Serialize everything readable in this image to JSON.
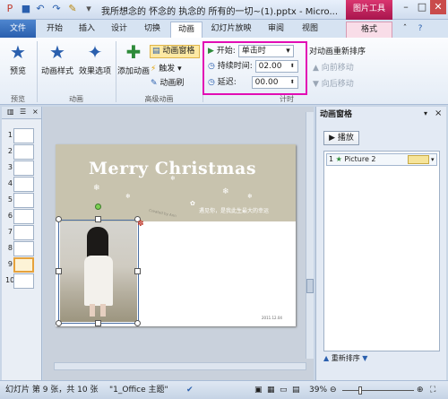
{
  "title_bar": {
    "doc_title": "我所想念的 怀念的 执念的 所有的一切~(1).pptx - Micro...",
    "picture_tools": "图片工具",
    "icons": [
      "save-icon",
      "undo-icon",
      "redo-icon",
      "format-painter-icon"
    ]
  },
  "tabs": {
    "file": "文件",
    "items": [
      "开始",
      "插入",
      "设计",
      "切换",
      "动画",
      "幻灯片放映",
      "审阅",
      "视图"
    ],
    "format": "格式"
  },
  "ribbon": {
    "preview": {
      "label": "预览",
      "group": "预览"
    },
    "animation": {
      "style": "动画样式",
      "effect": "效果选项",
      "group": "动画"
    },
    "advanced": {
      "add": "添加动画",
      "pane": "动画窗格",
      "trigger": "触发",
      "painter": "动画刷",
      "group": "高级动画"
    },
    "timing": {
      "start_label": "开始:",
      "start_value": "单击时",
      "duration_label": "持续时间:",
      "duration_value": "02.00",
      "delay_label": "延迟:",
      "delay_value": "00.00",
      "group": "计时"
    },
    "reorder": {
      "title": "对动画重新排序",
      "earlier": "向前移动",
      "later": "向后移动"
    }
  },
  "slides": {
    "numbers": [
      "1",
      "2",
      "3",
      "4",
      "5",
      "6",
      "7",
      "8",
      "9",
      "10"
    ],
    "active": "9"
  },
  "slide_content": {
    "title": "Merry Christmas",
    "poem": "遇见你，是我此生最大的幸运",
    "created": "Created by Ann",
    "date": "2011.12.04"
  },
  "anim_pane": {
    "title": "动画窗格",
    "play": "播放",
    "item_num": "1",
    "item_name": "Picture 2",
    "reorder": "重新排序"
  },
  "status": {
    "slide_info": "幻灯片 第 9 张，共 10 张",
    "theme": "\"1_Office 主题\"",
    "zoom": "39%"
  }
}
